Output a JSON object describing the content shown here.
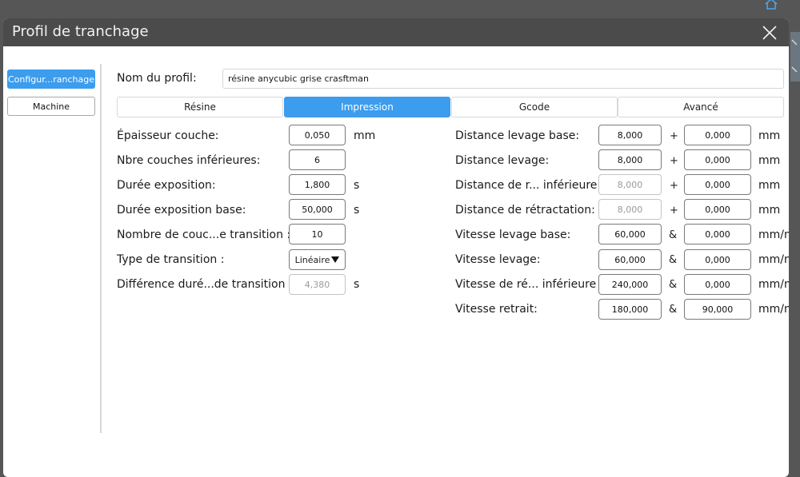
{
  "window": {
    "title": "Profil de tranchage"
  },
  "sidebar": {
    "items": [
      {
        "label": "Configur...ranchage",
        "active": true
      },
      {
        "label": "Machine",
        "active": false
      }
    ]
  },
  "profile": {
    "label": "Nom du profil:",
    "value": "résine anycubic grise crasftman"
  },
  "tabs": [
    {
      "label": "Résine",
      "active": false
    },
    {
      "label": "Impression",
      "active": true
    },
    {
      "label": "Gcode",
      "active": false
    },
    {
      "label": "Avancé",
      "active": false
    }
  ],
  "left_fields": [
    {
      "label": "Épaisseur couche:",
      "value": "0,050",
      "unit": "mm",
      "disabled": false
    },
    {
      "label": "Nbre couches inférieures:",
      "value": "6",
      "unit": "",
      "disabled": false
    },
    {
      "label": "Durée exposition:",
      "value": "1,800",
      "unit": "s",
      "disabled": false
    },
    {
      "label": "Durée exposition base:",
      "value": "50,000",
      "unit": "s",
      "disabled": false
    },
    {
      "label": "Nombre de couc...e transition :",
      "value": "10",
      "unit": "",
      "disabled": false
    },
    {
      "label": "Type de transition :",
      "value": "Linéaire",
      "unit": "",
      "dropdown": true
    },
    {
      "label": "Différence duré...de transition :",
      "value": "4,380",
      "unit": "s",
      "disabled": true
    }
  ],
  "right_fields": [
    {
      "label": "Distance levage base:",
      "value1": "8,000",
      "op": "+",
      "value2": "0,000",
      "unit": "mm",
      "disabled1": false
    },
    {
      "label": "Distance levage:",
      "value1": "8,000",
      "op": "+",
      "value2": "0,000",
      "unit": "mm",
      "disabled1": false
    },
    {
      "label": "Distance de r... inférieure :",
      "value1": "8,000",
      "op": "+",
      "value2": "0,000",
      "unit": "mm",
      "disabled1": true
    },
    {
      "label": "Distance de rétractation:",
      "value1": "8,000",
      "op": "+",
      "value2": "0,000",
      "unit": "mm",
      "disabled1": true
    },
    {
      "label": "Vitesse levage base:",
      "value1": "60,000",
      "op": "&",
      "value2": "0,000",
      "unit": "mm/m",
      "disabled1": false
    },
    {
      "label": "Vitesse levage:",
      "value1": "60,000",
      "op": "&",
      "value2": "0,000",
      "unit": "mm/m",
      "disabled1": false
    },
    {
      "label": "Vitesse de ré... inférieure :",
      "value1": "240,000",
      "op": "&",
      "value2": "0,000",
      "unit": "mm/m",
      "disabled1": false
    },
    {
      "label": "Vitesse retrait:",
      "value1": "180,000",
      "op": "&",
      "value2": "90,000",
      "unit": "mm/m",
      "disabled1": false
    }
  ],
  "colors": {
    "accent": "#3c9cee",
    "titlebar": "#4b4b4b",
    "backdrop": "#565656"
  }
}
